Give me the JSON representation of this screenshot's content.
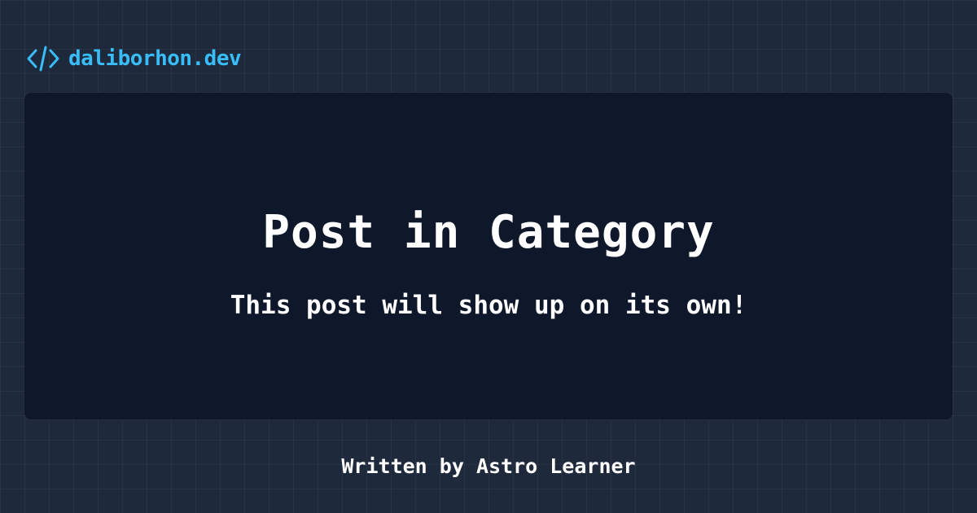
{
  "brand": {
    "name": "daliborhon.dev",
    "icon": "code-brackets-icon",
    "color": "#38bdf8"
  },
  "post": {
    "title": "Post in Category",
    "description": "This post will show up on its own!"
  },
  "footer": {
    "author_line": "Written by Astro Learner"
  },
  "colors": {
    "background": "#1e293b",
    "card": "#0f172a",
    "text": "#ffffff",
    "accent": "#38bdf8"
  }
}
